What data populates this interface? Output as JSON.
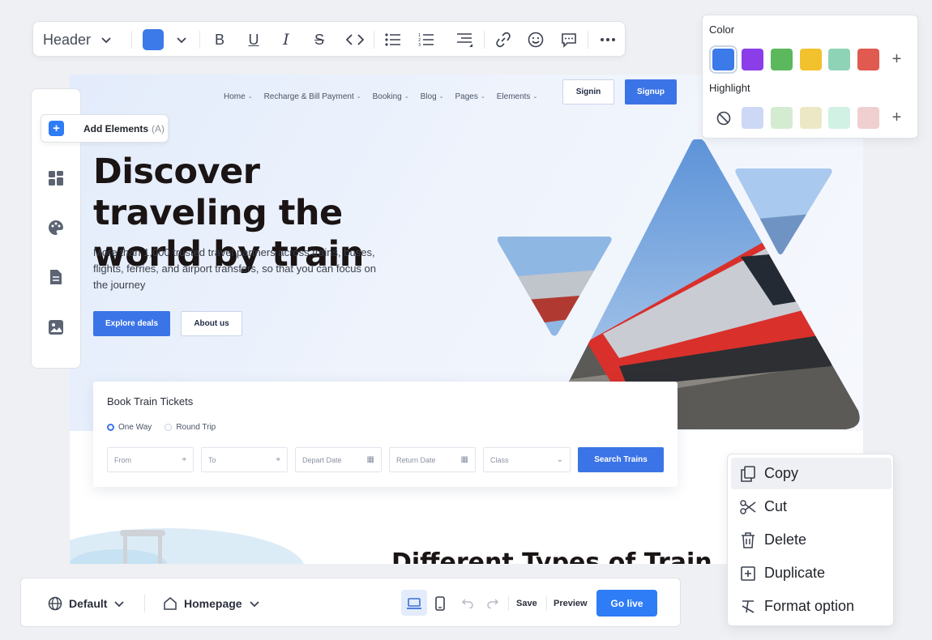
{
  "toolbar": {
    "style_select": "Header",
    "text_color": "#3b7ae8",
    "icons": [
      "chevron-down-icon",
      "bold-icon",
      "underline-icon",
      "italic-icon",
      "strikethrough-icon",
      "code-icon",
      "bullet-list-icon",
      "numbered-list-icon",
      "align-icon",
      "link-icon",
      "emoji-icon",
      "comment-icon",
      "more-icon"
    ]
  },
  "side_tools": {
    "add_elements_label": "Add Elements",
    "add_elements_shortcut": "(A)",
    "icons": [
      "add-icon",
      "layout-icon",
      "palette-icon",
      "page-icon",
      "media-icon"
    ]
  },
  "color_panel": {
    "color_label": "Color",
    "highlight_label": "Highlight",
    "colors": [
      "#3b7ae8",
      "#8a3de8",
      "#5cb85c",
      "#f2c12e",
      "#8fd3b7",
      "#e05a4f"
    ],
    "highlights": [
      "#cdd8f6",
      "#d3ecd1",
      "#ece8c6",
      "#d1f1e4",
      "#f0cfd0"
    ]
  },
  "context_menu": {
    "items": [
      {
        "label": "Copy",
        "icon": "copy-icon"
      },
      {
        "label": "Cut",
        "icon": "scissors-icon"
      },
      {
        "label": "Delete",
        "icon": "trash-icon"
      },
      {
        "label": "Duplicate",
        "icon": "duplicate-icon"
      },
      {
        "label": "Format option",
        "icon": "clear-format-icon"
      }
    ]
  },
  "bottom_bar": {
    "language": "Default",
    "page": "Homepage",
    "save": "Save",
    "preview": "Preview",
    "go_live": "Go live"
  },
  "site": {
    "nav": [
      "Home",
      "Recharge & Bill Payment",
      "Booking",
      "Blog",
      "Pages",
      "Elements"
    ],
    "signin": "Signin",
    "signup": "Signup",
    "hero_title": "Discover traveling the world by train",
    "hero_subtitle": "More than 1,000 trusted travel partners across trains, buses, flights, ferries, and airport transfers, so that you can focus on the journey",
    "explore": "Explore deals",
    "about": "About us",
    "booking": {
      "title": "Book Train Tickets",
      "one_way": "One Way",
      "round_trip": "Round Trip",
      "from": "From",
      "to": "To",
      "depart": "Depart Date",
      "return": "Return Date",
      "class": "Class",
      "search": "Search Trains"
    },
    "section_title": "Different Types of Train"
  }
}
